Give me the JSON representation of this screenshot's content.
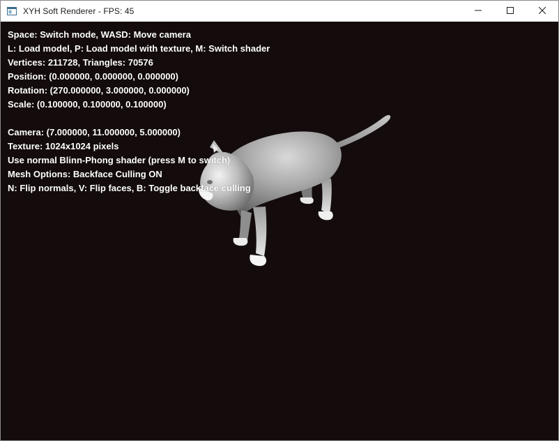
{
  "window": {
    "title": "XYH Soft Renderer - FPS: 45",
    "icon": "app-window-icon",
    "controls": [
      "minimize-icon",
      "maximize-icon",
      "close-icon"
    ]
  },
  "overlay": {
    "lines": [
      "Space: Switch mode, WASD: Move camera",
      "L: Load model, P: Load model with texture, M: Switch shader",
      "Vertices: 211728, Triangles: 70576",
      "Position: (0.000000, 0.000000, 0.000000)",
      "Rotation: (270.000000, 3.000000, 0.000000)",
      "Scale: (0.100000, 0.100000, 0.100000)",
      "",
      "Camera: (7.000000, 11.000000, 5.000000)",
      "Texture: 1024x1024 pixels",
      "Use normal Blinn-Phong shader (press M to switch)",
      "Mesh Options: Backface Culling ON",
      "N: Flip normals, V: Flip faces, B: Toggle backface culling"
    ]
  },
  "colors": {
    "viewport_background": "#140c0c",
    "overlay_text": "#ffffff",
    "titlebar": "#ffffff"
  }
}
